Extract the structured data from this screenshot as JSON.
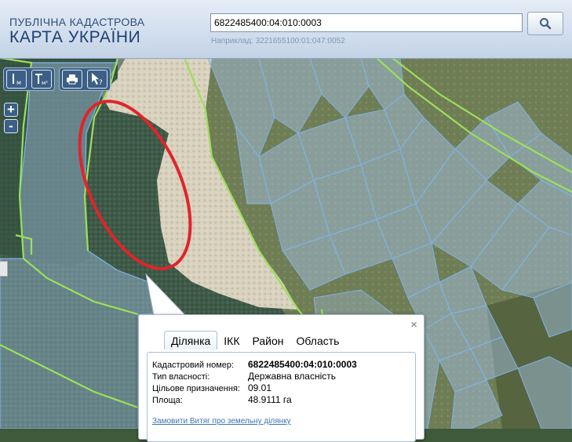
{
  "header": {
    "logo_line1": "ПУБЛІЧНА КАДАСТРОВА",
    "logo_line2": "КАРТА УКРАЇНИ",
    "search_value": "6822485400:04:010:0003",
    "search_hint": "Наприклад: 3221655100:01:047:0052"
  },
  "toolbar": {
    "measure_length_label": "м",
    "measure_area_label": "м²",
    "print_icon": "print-icon",
    "info_icon": "identify-cursor-icon"
  },
  "zoom": {
    "in_label": "+",
    "out_label": "-"
  },
  "popup": {
    "close_label": "×",
    "tabs": [
      {
        "label": "Ділянка",
        "active": true
      },
      {
        "label": "ІКК",
        "active": false
      },
      {
        "label": "Район",
        "active": false
      },
      {
        "label": "Область",
        "active": false
      }
    ],
    "fields": {
      "cadastral_key": "Кадастровий номер:",
      "cadastral_value": "6822485400:04:010:0003",
      "ownership_key": "Тип власності:",
      "ownership_value": "Державна власність",
      "purpose_key": "Цільове призначення:",
      "purpose_value": "09.01",
      "area_key": "Площа:",
      "area_value": "48.9111 га"
    },
    "order_link": "Замовити Витяг про земельну ділянку"
  },
  "colors": {
    "parcel_fill": "#a9c8f0",
    "parcel_stroke": "#7fb2e8",
    "boundary_green": "#9be05a",
    "highlight_red": "#e0242a",
    "forest": "#3d5b46",
    "sand": "#d8d2c0"
  }
}
